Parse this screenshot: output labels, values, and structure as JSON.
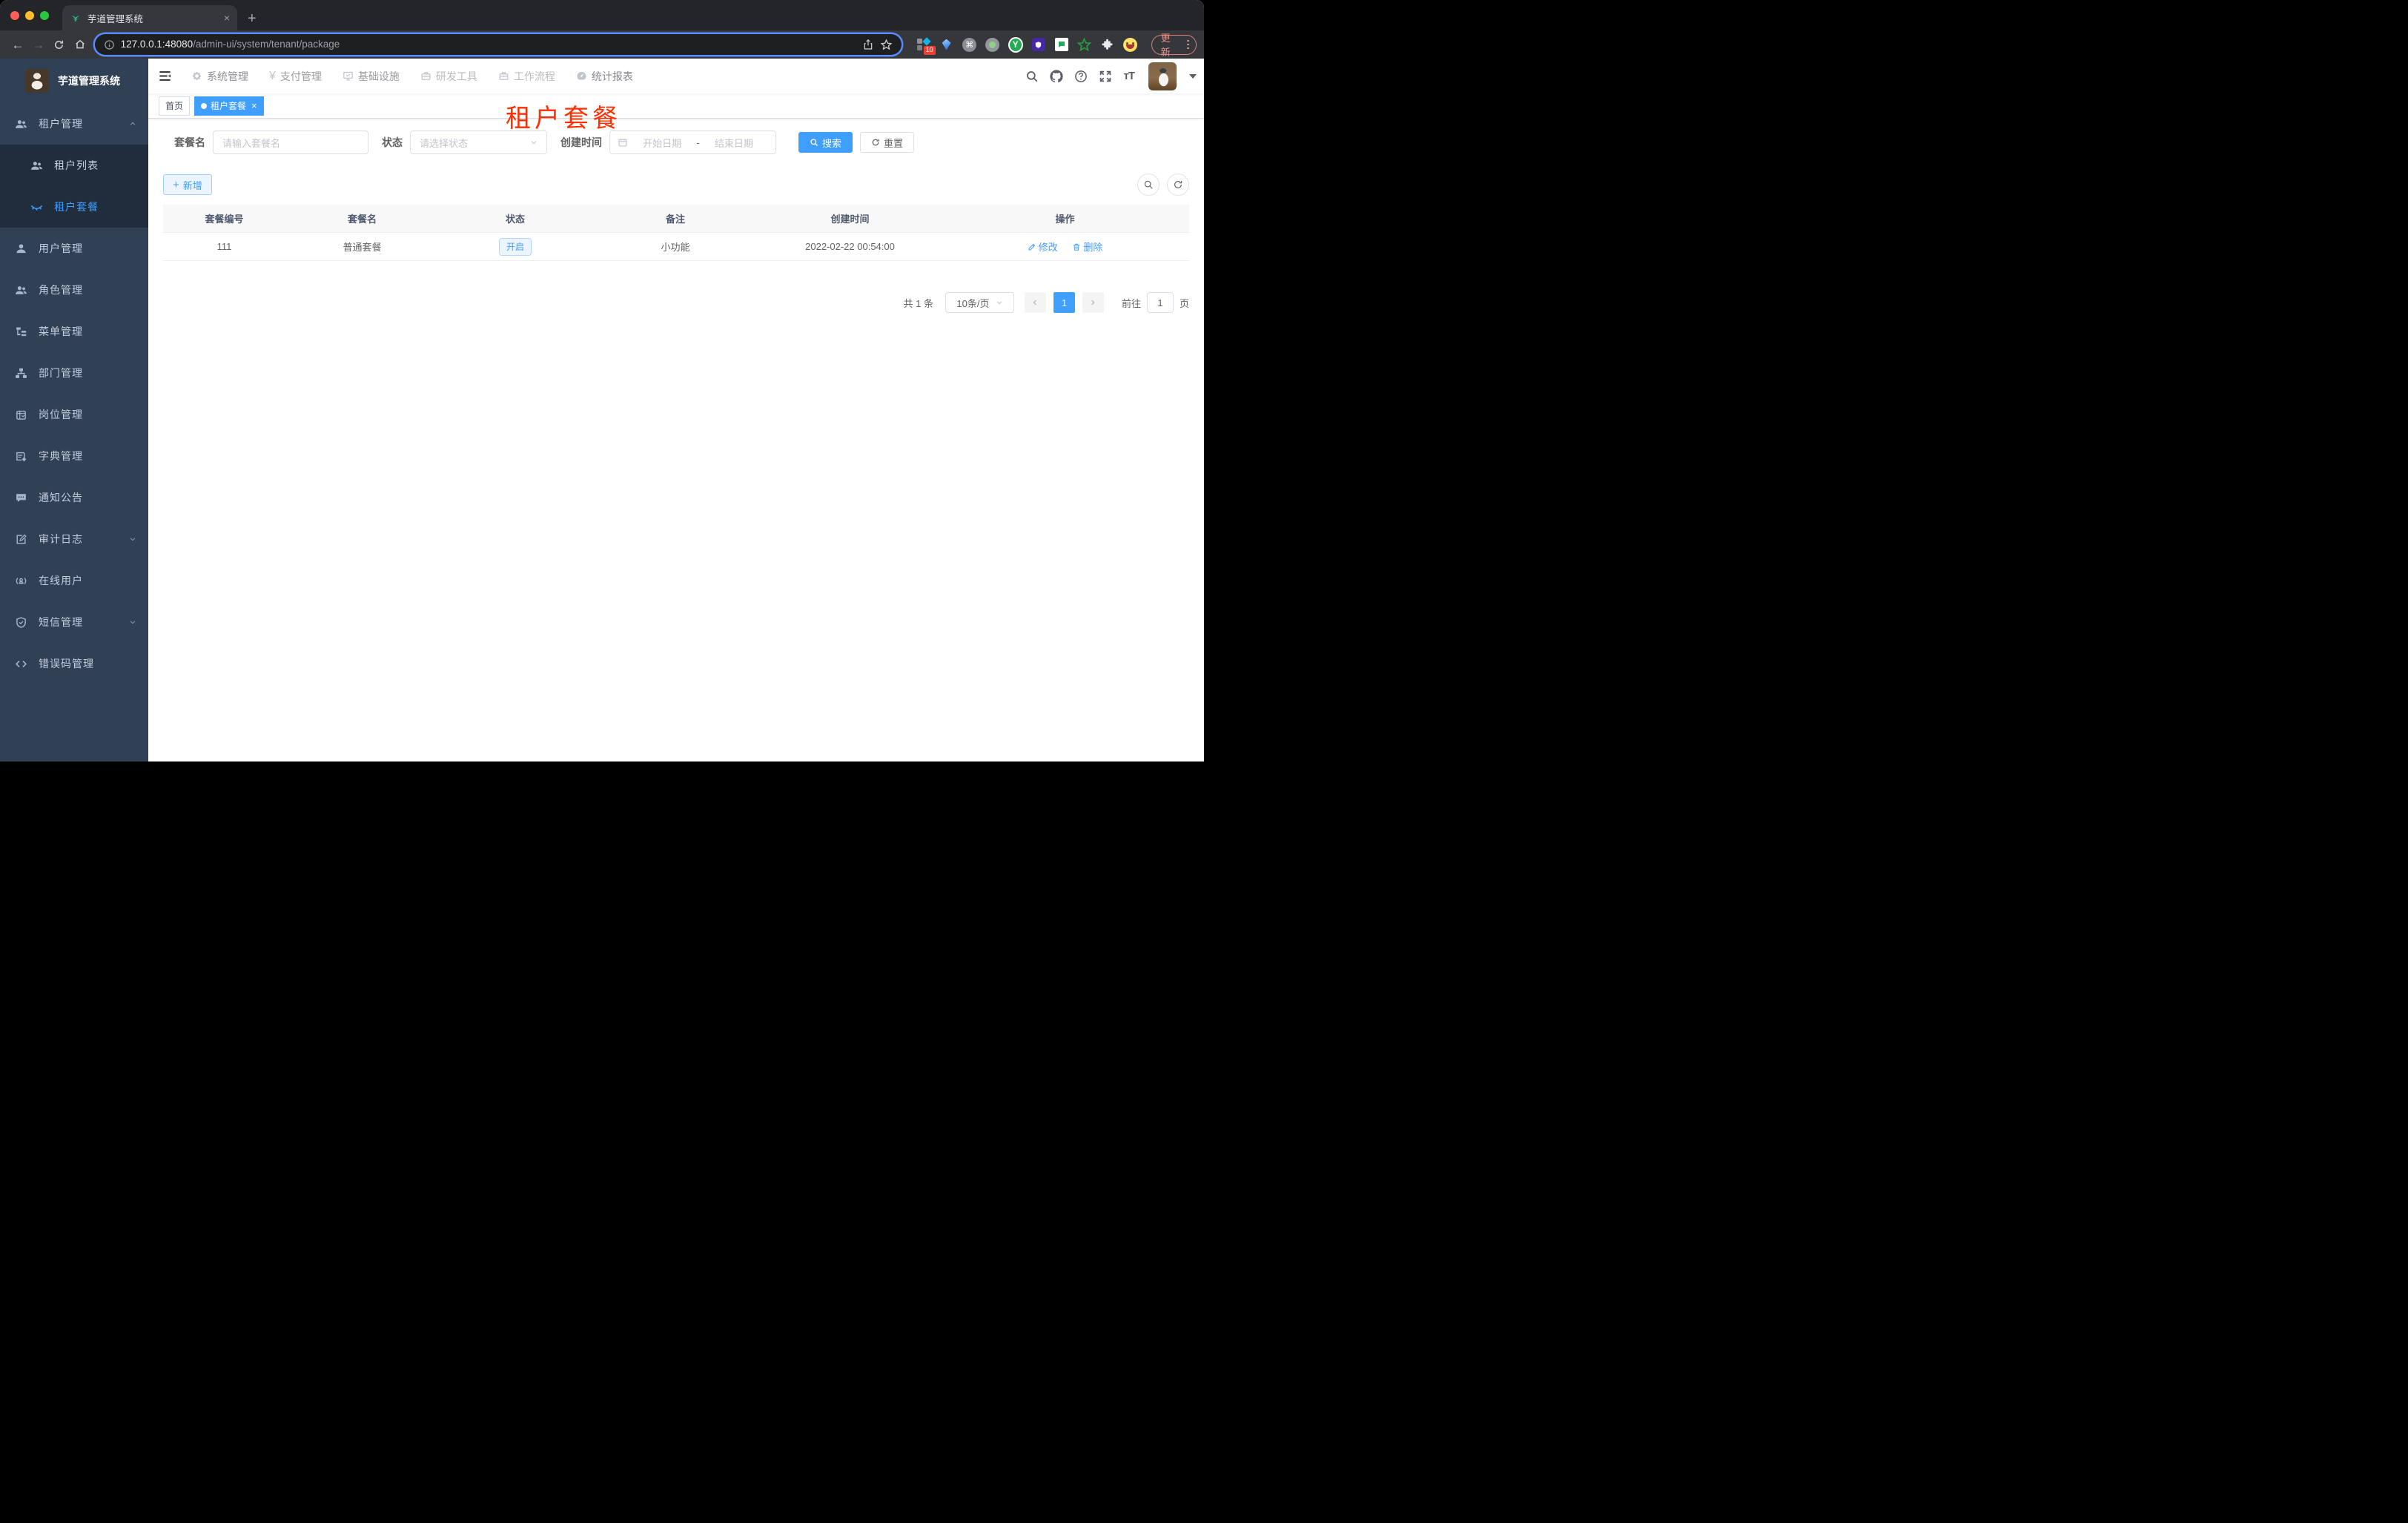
{
  "browser": {
    "tab_title": "芋道管理系统",
    "tab_close": "×",
    "new_tab": "+",
    "url_host": "127.0.0.1:48080",
    "url_path": "/admin-ui/system/tenant/package",
    "extension_badge": "10",
    "extension_y": "Y",
    "extension_cmd": "⌘",
    "update_label": "更新",
    "colors": {
      "focus_ring": "#5a8bff",
      "traffic_red": "#ff5f57",
      "traffic_yellow": "#febc2e",
      "traffic_green": "#28c840"
    }
  },
  "app": {
    "logo_title": "芋道管理系统",
    "top_nav": {
      "items": [
        {
          "label": "系统管理",
          "icon": "gear-icon"
        },
        {
          "label": "支付管理",
          "icon": "yen-icon"
        },
        {
          "label": "基础设施",
          "icon": "monitor-icon"
        },
        {
          "label": "研发工具",
          "icon": "briefcase-icon"
        },
        {
          "label": "工作流程",
          "icon": "briefcase-icon"
        },
        {
          "label": "统计报表",
          "icon": "dashboard-icon"
        }
      ],
      "yen": "¥"
    },
    "sidebar": {
      "items": [
        {
          "label": "租户管理",
          "icon": "peoples-icon",
          "expanded": true
        },
        {
          "label": "租户列表",
          "icon": "peoples-icon",
          "submenu": true
        },
        {
          "label": "租户套餐",
          "icon": "closed-eye-icon",
          "submenu": true,
          "active": true
        },
        {
          "label": "用户管理",
          "icon": "user-icon"
        },
        {
          "label": "角色管理",
          "icon": "peoples-icon"
        },
        {
          "label": "菜单管理",
          "icon": "tree-table-icon"
        },
        {
          "label": "部门管理",
          "icon": "org-tree-icon"
        },
        {
          "label": "岗位管理",
          "icon": "post-icon"
        },
        {
          "label": "字典管理",
          "icon": "dict-icon"
        },
        {
          "label": "通知公告",
          "icon": "message-icon"
        },
        {
          "label": "审计日志",
          "icon": "log-icon",
          "collapsible": true
        },
        {
          "label": "在线用户",
          "icon": "online-icon"
        },
        {
          "label": "短信管理",
          "icon": "shield-icon",
          "collapsible": true
        },
        {
          "label": "错误码管理",
          "icon": "code-icon"
        }
      ]
    },
    "tags": {
      "home": "首页",
      "active": "租户套餐",
      "close": "×"
    },
    "overlay_title": "租户套餐",
    "filters": {
      "name_label": "套餐名",
      "name_placeholder": "请输入套餐名",
      "status_label": "状态",
      "status_placeholder": "请选择状态",
      "date_label": "创建时间",
      "date_start_placeholder": "开始日期",
      "date_separator": "-",
      "date_end_placeholder": "结束日期",
      "search_label": "搜索",
      "reset_label": "重置"
    },
    "toolbar": {
      "add_label": "新增",
      "plus": "+"
    },
    "table": {
      "headers": [
        "套餐编号",
        "套餐名",
        "状态",
        "备注",
        "创建时间",
        "操作"
      ],
      "rows": [
        {
          "id": "111",
          "name": "普通套餐",
          "status": "开启",
          "remark": "小功能",
          "created": "2022-02-22 00:54:00",
          "edit": "修改",
          "delete": "删除"
        }
      ]
    },
    "pagination": {
      "total": "共 1 条",
      "page_size": "10条/页",
      "current_page": "1",
      "goto_label": "前往",
      "goto_value": "1",
      "page_unit": "页"
    },
    "colors": {
      "accent": "#409eff",
      "overlay_red": "#ff2e00",
      "sidebar_bg": "#304156",
      "submenu_bg": "#1f2d3d"
    }
  }
}
